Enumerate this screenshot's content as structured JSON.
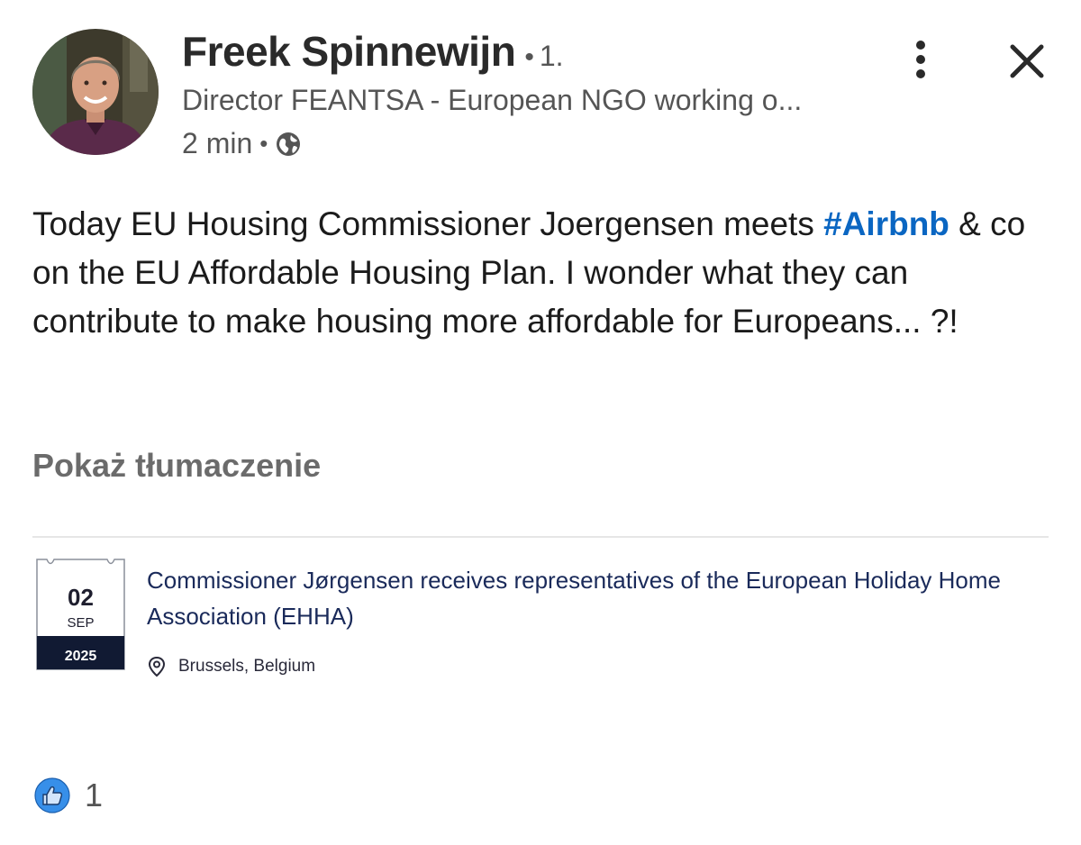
{
  "post": {
    "author": {
      "name": "Freek Spinnewijn",
      "separator": "•",
      "connection_degree": "1.",
      "headline": "Director FEANTSA - European NGO working o...",
      "time": "2 min",
      "meta_separator": "•",
      "visibility_icon": "globe-icon",
      "avatar_icon": "profile-photo"
    },
    "actions": {
      "more_icon": "more-vertical-icon",
      "close_icon": "close-icon"
    },
    "text": {
      "part1": "Today EU Housing Commissioner Joergensen meets ",
      "hashtag": "#Airbnb",
      "part2": " & co on the EU Affordable Housing Plan.  I wonder what they can contribute to make housing more affordable for Europeans... ?!"
    },
    "translate_label": "Pokaż tłumaczenie",
    "event": {
      "day": "02",
      "month": "SEP",
      "year": "2025",
      "title": "Commissioner Jørgensen receives representatives of the European Holiday Home Association (EHHA)",
      "location": "Brussels, Belgium",
      "location_icon": "location-pin-icon"
    },
    "reactions": {
      "icon": "like-icon",
      "count": "1"
    }
  },
  "colors": {
    "link_blue": "#0a66c2",
    "secondary_text": "#555555",
    "calendar_dark": "#111a33"
  }
}
